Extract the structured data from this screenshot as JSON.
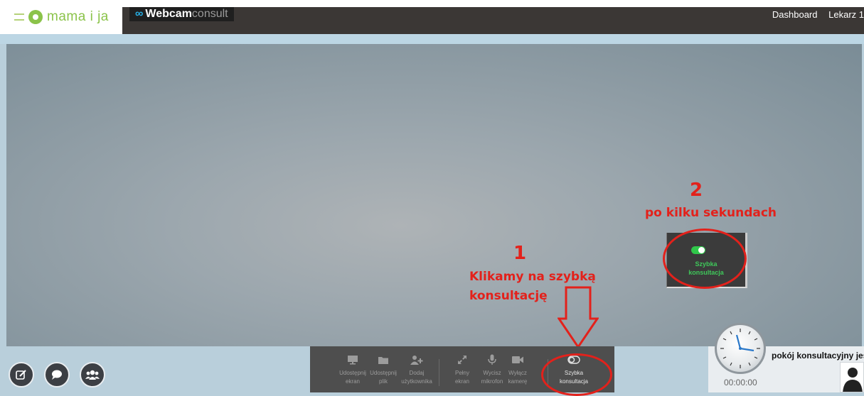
{
  "brand": {
    "logo_text": "mama i ja"
  },
  "app": {
    "logo_text_strong": "Webcam",
    "logo_text_light": "consult"
  },
  "nav": {
    "dashboard": "Dashboard",
    "user": "Lekarz 1"
  },
  "annotations": {
    "step1_number": "1",
    "step1_line1": "Klikamy na szybką",
    "step1_line2": "konsultację",
    "step2_number": "2",
    "step2_text": "po kilku sekundach"
  },
  "preview": {
    "line1": "Szybka",
    "line2": "konsultacja"
  },
  "toolbar": {
    "share_screen": {
      "line1": "Udostępnij",
      "line2": "ekran",
      "icon": "monitor-icon"
    },
    "share_file": {
      "line1": "Udostępnij",
      "line2": "plik",
      "icon": "folder-icon"
    },
    "add_user": {
      "line1": "Dodaj",
      "line2": "użytkownika",
      "icon": "add-user-icon"
    },
    "fullscreen": {
      "line1": "Pełny",
      "line2": "ekran",
      "icon": "expand-icon"
    },
    "mute_mic": {
      "line1": "Wycisz",
      "line2": "mikrofon",
      "icon": "microphone-icon"
    },
    "camera_off": {
      "line1": "Wyłącz",
      "line2": "kamerę",
      "icon": "camera-icon"
    },
    "quick_consult": {
      "line1": "Szybka",
      "line2": "konsultacja",
      "icon": "toggle-icon"
    }
  },
  "room": {
    "status": "pokój konsultacyjny jest",
    "timer": "00:00:00"
  },
  "colors": {
    "annotation_red": "#e3211b",
    "toggle_green": "#30c74a",
    "brand_green": "#8bc34a"
  }
}
